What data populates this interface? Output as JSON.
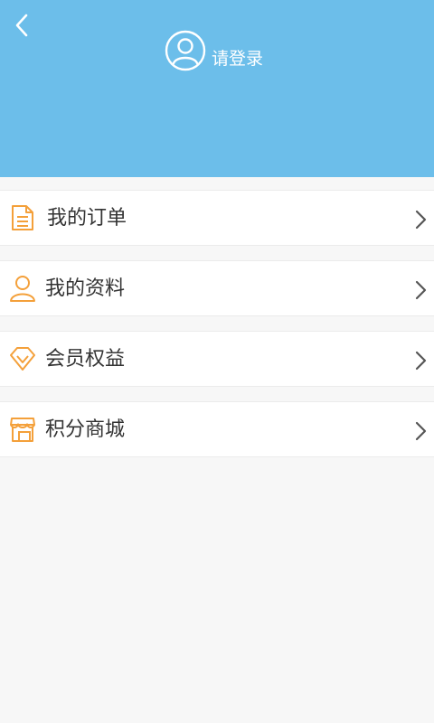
{
  "header": {
    "login_label": "请登录",
    "background_color": "#6cbeea",
    "back_icon": "chevron-left-icon",
    "avatar_icon": "user-circle-icon"
  },
  "menu": {
    "accent_color": "#f4a03a",
    "items": [
      {
        "label": "我的订单",
        "icon": "document-icon"
      },
      {
        "label": "我的资料",
        "icon": "person-icon"
      },
      {
        "label": "会员权益",
        "icon": "diamond-icon"
      },
      {
        "label": "积分商城",
        "icon": "store-icon"
      }
    ]
  }
}
